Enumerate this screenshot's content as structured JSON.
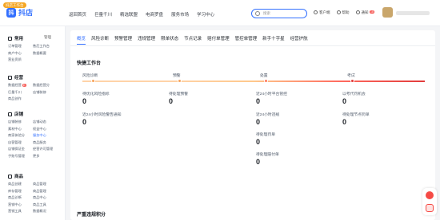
{
  "header": {
    "logo_badge": "抖店工作台",
    "logo_text": "抖店",
    "nav": [
      "返回首页",
      "巨量千川",
      "精选联盟",
      "电商罗盘",
      "服务市场",
      "学习中心"
    ],
    "search_placeholder": "搜索",
    "right": [
      "客户端",
      "帮助",
      "通知"
    ],
    "notify_count": "18"
  },
  "sidebar": {
    "manage_label": "管理",
    "groups": [
      {
        "title": "常用",
        "items": [
          "订单管理",
          "售后工作台",
          "商户中心",
          "数据概要",
          "营业资质"
        ]
      },
      {
        "title": "经营",
        "items": [
          "数据经营",
          "数据经营分",
          "巨量千川",
          "店铺装修",
          "商品创作"
        ],
        "badge": "新"
      },
      {
        "title": "店铺",
        "items": [
          "店铺装修",
          "店铺动态",
          "素材中心",
          "权益中心",
          "商家体验分",
          "服务中心",
          "自营管理",
          "商品服务",
          "店铺保证金",
          "经营许可管理",
          "子账号管理",
          "更多"
        ]
      },
      {
        "title": "商品",
        "items": [
          "商品创建",
          "商品管理",
          "库存管理",
          "商品管理",
          "商品诊断",
          "商品中心",
          "营销中心",
          "商品工具",
          "营销工具",
          "数据概况"
        ]
      }
    ]
  },
  "tabs": [
    "概览",
    "风险诊断",
    "预警管理",
    "违规管理",
    "限单状态",
    "节点记录",
    "赔付单管理",
    "管控单管理",
    "新手十字星",
    "经营护航"
  ],
  "active_tab": 0,
  "quick_title": "快捷工作台",
  "stages": [
    "风险诊断",
    "预警",
    "处置",
    "考试"
  ],
  "metrics": [
    {
      "label": "待优化风险指标",
      "value": "0"
    },
    {
      "label": "待处理预警",
      "value": "0"
    },
    {
      "label": "近24小时平台管控",
      "value": "0"
    },
    {
      "label": "以考代罚机会",
      "value": "0"
    },
    {
      "label": "近24小时风险警告通知",
      "value": "0"
    },
    {
      "label": "近24小时违规",
      "value": "0"
    },
    {
      "label": "待处理节点罚单",
      "value": "0"
    },
    {
      "label": "待处理罚单",
      "value": "0"
    },
    {
      "label": "待处理赔付单",
      "value": "0"
    }
  ],
  "section2_title": "严重违规积分",
  "colors": {
    "accent": "#3370ff",
    "warn": "#f7a35c",
    "danger": "#e23b3b"
  }
}
